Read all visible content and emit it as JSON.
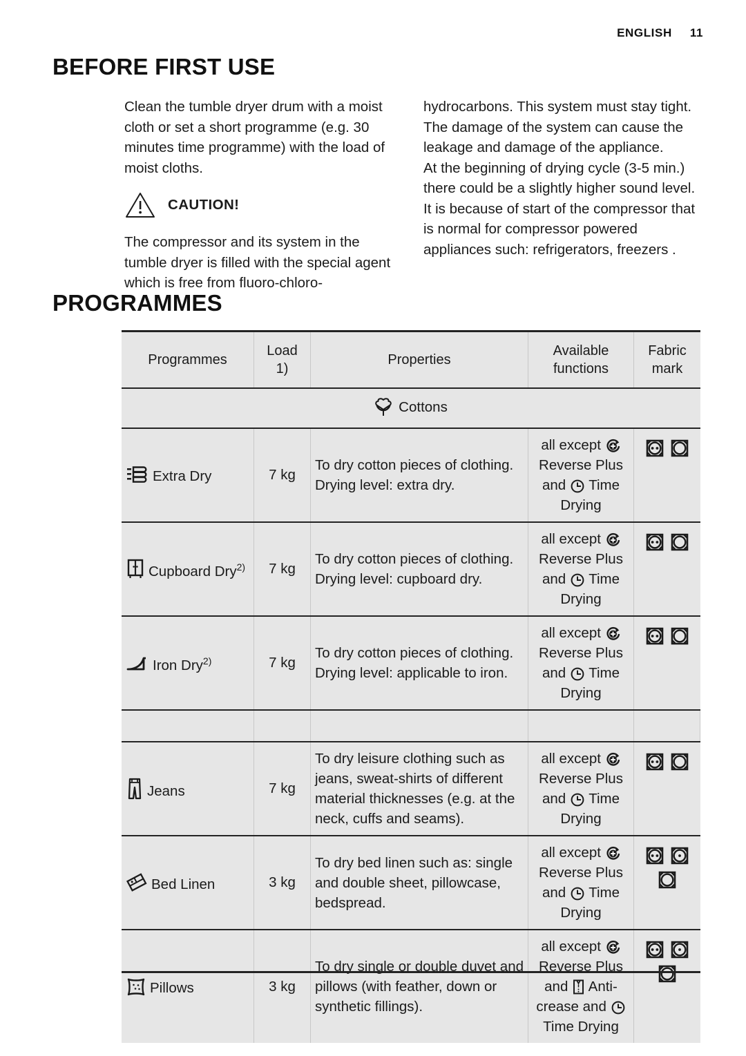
{
  "header": {
    "language": "ENGLISH",
    "page_number": "11"
  },
  "sections": {
    "before_first_use": {
      "title": "BEFORE FIRST USE",
      "left_paragraph_1": "Clean the tumble dryer drum with a moist cloth or set a short programme (e.g. 30 minutes time programme) with the load of moist cloths.",
      "caution_label": "CAUTION!",
      "left_paragraph_2": "The compressor and its system in the tumble dryer is filled with the special agent which is free from fluoro-chloro-",
      "right_paragraph_1": "hydrocarbons. This system must stay tight. The damage of the system can cause the leakage and damage of the appliance.",
      "right_paragraph_2": "At the beginning of drying cycle (3-5 min.) there could be a slightly higher sound level. It is because of start of the compressor that is normal for compressor powered appliances such: refrigerators, freezers ."
    },
    "programmes": {
      "title": "PROGRAMMES"
    }
  },
  "table": {
    "headers": {
      "programmes": "Programmes",
      "load": "Load",
      "load_note": "1)",
      "properties": "Properties",
      "available_functions_line1": "Available",
      "available_functions_line2": "functions",
      "fabric_mark_line1": "Fabric",
      "fabric_mark_line2": "mark"
    },
    "categories": [
      {
        "label": "Cottons",
        "icon": "cotton-boll-icon"
      }
    ],
    "rows": [
      {
        "icon": "folded-laundry-stack-icon",
        "name": "Extra Dry",
        "note": "",
        "load": "7 kg",
        "properties": "To dry cotton pieces of clothing. Drying level: extra dry.",
        "functions_text": "all except ⟳ Reverse Plus and ◷ Time Drying",
        "functions_parts": {
          "a": "all except",
          "b": "Reverse Plus",
          "c": "and",
          "d": "Time",
          "e": "Drying"
        },
        "fabric_marks": [
          "tumble-dry-two-dots",
          "tumble-dry-plain"
        ]
      },
      {
        "icon": "cupboard-icon",
        "name": "Cupboard Dry",
        "note": "2)",
        "load": "7 kg",
        "properties": "To dry cotton pieces of clothing. Drying level: cupboard dry.",
        "functions_parts": {
          "a": "all except",
          "b": "Reverse Plus",
          "c": "and",
          "d": "Time",
          "e": "Drying"
        },
        "fabric_marks": [
          "tumble-dry-two-dots",
          "tumble-dry-plain"
        ]
      },
      {
        "icon": "iron-icon",
        "name": "Iron Dry",
        "note": "2)",
        "load": "7 kg",
        "properties": "To dry cotton pieces of clothing. Drying level: applicable to iron.",
        "functions_parts": {
          "a": "all except",
          "b": "Reverse Plus",
          "c": "and",
          "d": "Time",
          "e": "Drying"
        },
        "fabric_marks": [
          "tumble-dry-two-dots",
          "tumble-dry-plain"
        ]
      },
      {
        "icon": "jeans-icon",
        "name": "Jeans",
        "note": "",
        "load": "7 kg",
        "properties": "To dry leisure clothing such as jeans, sweat-shirts of different material thicknesses (e.g. at the neck, cuffs and seams).",
        "functions_parts": {
          "a": "all except",
          "b": "Reverse Plus",
          "c": "and",
          "d": "Time",
          "e": "Drying"
        },
        "fabric_marks": [
          "tumble-dry-two-dots",
          "tumble-dry-plain"
        ]
      },
      {
        "icon": "bed-linen-icon",
        "name": "Bed Linen",
        "note": "",
        "load": "3 kg",
        "properties": "To dry bed linen such as: single and double sheet, pillowcase, bedspread.",
        "functions_parts": {
          "a": "all except",
          "b": "Reverse Plus",
          "c": "and",
          "d": "Time",
          "e": "Drying"
        },
        "fabric_marks": [
          "tumble-dry-two-dots",
          "tumble-dry-one-dot",
          "tumble-dry-plain"
        ]
      },
      {
        "icon": "pillow-icon",
        "name": "Pillows",
        "note": "",
        "load": "3 kg",
        "properties": "To dry single or double duvet and pillows (with feather, down or synthetic fillings).",
        "functions_parts": {
          "a": "all except",
          "b": "Reverse Plus",
          "c": "and",
          "d": "Anti-",
          "e": "crease and",
          "f": "Time Drying"
        },
        "fabric_marks": [
          "tumble-dry-two-dots",
          "tumble-dry-one-dot",
          "tumble-dry-plain"
        ]
      }
    ]
  },
  "colors": {
    "table_background": "#e6e6e6",
    "rule": "#232323",
    "text": "#1b1b1b"
  }
}
